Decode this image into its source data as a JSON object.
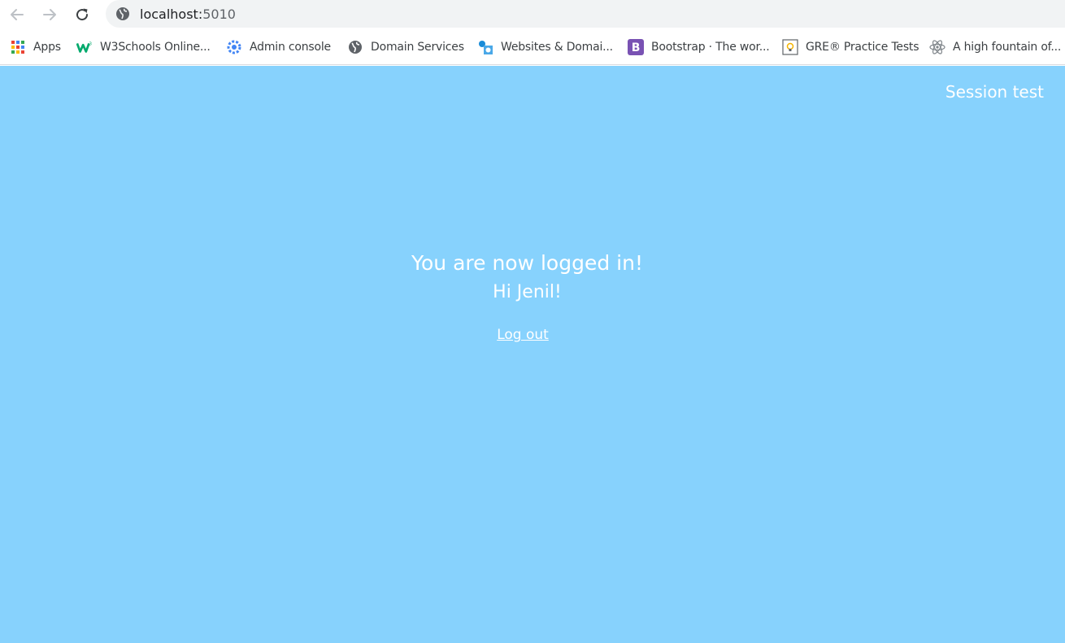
{
  "browser": {
    "url_host": "localhost:",
    "url_port": "5010",
    "icons": {
      "back": "arrow-left-icon",
      "forward": "arrow-right-icon",
      "reload": "reload-icon",
      "site": "globe-icon"
    }
  },
  "bookmarks": [
    {
      "label": "Apps",
      "icon": "apps-grid-icon"
    },
    {
      "label": "W3Schools Online...",
      "icon": "w3schools-icon"
    },
    {
      "label": "Admin console",
      "icon": "admin-console-icon"
    },
    {
      "label": "Domain Services",
      "icon": "globe-icon"
    },
    {
      "label": "Websites & Domai...",
      "icon": "websites-domains-icon"
    },
    {
      "label": "Bootstrap · The wor...",
      "icon": "bootstrap-icon"
    },
    {
      "label": "GRE® Practice Tests",
      "icon": "gre-icon"
    },
    {
      "label": "A high fountain of...",
      "icon": "atom-icon"
    }
  ],
  "page": {
    "site_title": "Session test",
    "message": "You are now logged in!",
    "greeting": "Hi Jenil!",
    "logout_label": "Log out",
    "background_color": "#87d2fd",
    "text_color": "#ffffff"
  }
}
